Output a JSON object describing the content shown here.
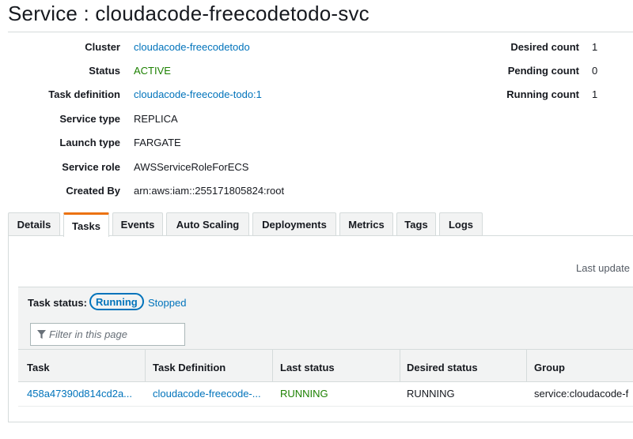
{
  "page": {
    "title": "Service : cloudacode-freecodetodo-svc"
  },
  "details": [
    {
      "label": "Cluster",
      "value": "cloudacode-freecodetodo"
    },
    {
      "label": "Status",
      "value": "ACTIVE"
    },
    {
      "label": "Task definition",
      "value": "cloudacode-freecode-todo:1"
    },
    {
      "label": "Service type",
      "value": "REPLICA"
    },
    {
      "label": "Launch type",
      "value": "FARGATE"
    },
    {
      "label": "Service role",
      "value": "AWSServiceRoleForECS"
    },
    {
      "label": "Created By",
      "value": "arn:aws:iam::255171805824:root"
    }
  ],
  "counts": [
    {
      "label": "Desired count",
      "value": "1"
    },
    {
      "label": "Pending count",
      "value": "0"
    },
    {
      "label": "Running count",
      "value": "1"
    }
  ],
  "tabs": [
    "Details",
    "Tasks",
    "Events",
    "Auto Scaling",
    "Deployments",
    "Metrics",
    "Tags",
    "Logs"
  ],
  "selected_tab": "Tasks",
  "last_updated": "Last update",
  "task_status": {
    "label": "Task status:",
    "running": "Running",
    "stopped": "Stopped"
  },
  "filter": {
    "placeholder": "Filter in this page"
  },
  "table": {
    "columns": [
      "Task",
      "Task Definition",
      "Last status",
      "Desired status",
      "Group"
    ],
    "rows": [
      [
        "458a47390d814cd2a...",
        "cloudacode-freecode-...",
        "RUNNING",
        "RUNNING",
        "service:cloudacode-f"
      ]
    ]
  },
  "colors": {
    "accent_tab": "#ec7211",
    "link": "#0073bb",
    "active": "#1d8102"
  }
}
